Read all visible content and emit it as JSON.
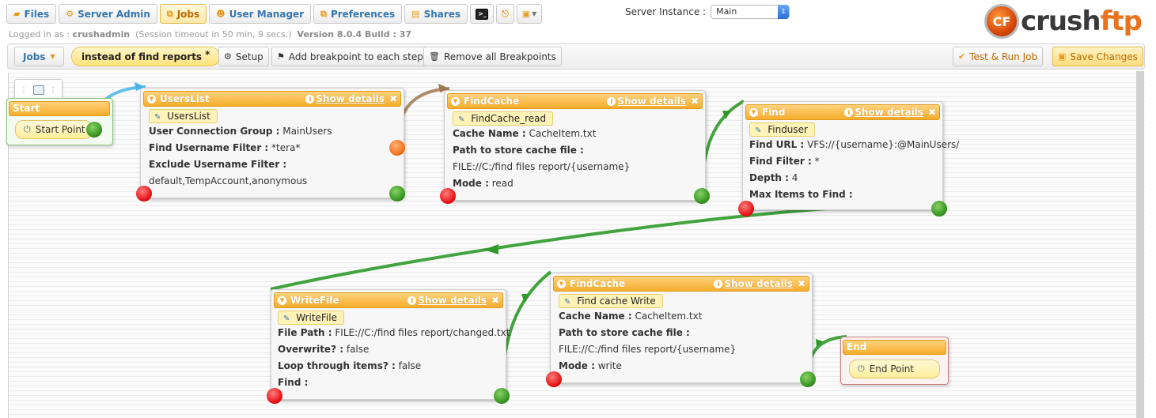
{
  "nav": {
    "tabs": [
      {
        "label": "Files",
        "icon": "folder-icon"
      },
      {
        "label": "Server Admin",
        "icon": "gear-icon"
      },
      {
        "label": "Jobs",
        "icon": "jobs-icon"
      },
      {
        "label": "User Manager",
        "icon": "user-icon"
      },
      {
        "label": "Preferences",
        "icon": "preferences-icon"
      },
      {
        "label": "Shares",
        "icon": "shares-icon"
      }
    ],
    "active_tab": "Jobs"
  },
  "session": {
    "logged_in_prefix": "Logged in as :",
    "username": "crushadmin",
    "timeout": "(Session timeout in 50 min, 9 secs.)",
    "version": "Version 8.0.4 Build : 37"
  },
  "server_instance": {
    "label": "Server Instance :",
    "value": "Main"
  },
  "logo": {
    "word_a": "crush",
    "word_b": "ftp",
    "mark": "CF"
  },
  "toolbar": {
    "jobs_label": "Jobs",
    "job_name": "instead of find reports",
    "job_modified_mark": "*",
    "setup_label": "Setup",
    "add_breakpoint_label": "Add breakpoint to each step",
    "remove_breakpoints_label": "Remove all Breakpoints",
    "test_run_label": "Test & Run Job",
    "save_label": "Save Changes"
  },
  "flow": {
    "show_details": "Show details",
    "start": {
      "title": "Start",
      "point_label": "Start Point"
    },
    "end": {
      "title": "End",
      "point_label": "End Point"
    },
    "userslist": {
      "title": "UsersList",
      "tag": "UsersList",
      "rows": [
        {
          "k": "User Connection Group :",
          "v": "MainUsers"
        },
        {
          "k": "Find Username Filter :",
          "v": "*tera*"
        },
        {
          "k": "Exclude Username Filter :",
          "v": ""
        },
        {
          "k": "",
          "v": "default,TempAccount,anonymous"
        }
      ]
    },
    "findcache_read": {
      "title": "FindCache",
      "tag": "FindCache_read",
      "rows": [
        {
          "k": "Cache Name :",
          "v": "CacheItem.txt"
        },
        {
          "k": "Path to store cache file :",
          "v": ""
        },
        {
          "k": "",
          "v": "FILE://C:/find files report/{username}"
        },
        {
          "k": "Mode :",
          "v": "read"
        }
      ]
    },
    "find": {
      "title": "Find",
      "tag": "Finduser",
      "rows": [
        {
          "k": "Find URL :",
          "v": "VFS://{username}:@MainUsers/"
        },
        {
          "k": "Find Filter :",
          "v": "*"
        },
        {
          "k": "Depth :",
          "v": "4"
        },
        {
          "k": "Max Items to Find :",
          "v": ""
        }
      ]
    },
    "writefile": {
      "title": "WriteFile",
      "tag": "WriteFile",
      "rows": [
        {
          "k": "File Path :",
          "v": "FILE://C:/find files report/changed.txt"
        },
        {
          "k": "Overwrite? :",
          "v": "false"
        },
        {
          "k": "Loop through items? :",
          "v": "false"
        },
        {
          "k": "Find :",
          "v": ""
        }
      ]
    },
    "findcache_write": {
      "title": "FindCache",
      "tag": "Find cache Write",
      "rows": [
        {
          "k": "Cache Name :",
          "v": "CacheItem.txt"
        },
        {
          "k": "Path to store cache file :",
          "v": ""
        },
        {
          "k": "",
          "v": "FILE://C:/find files report/{username}"
        },
        {
          "k": "Mode :",
          "v": "write"
        }
      ]
    }
  },
  "colors": {
    "accent_orange": "#f5ad2c",
    "link_blue": "#3576ae",
    "wire_green": "#2f9a2a",
    "wire_blue": "#4ab6e8",
    "wire_brown": "#a07850"
  }
}
